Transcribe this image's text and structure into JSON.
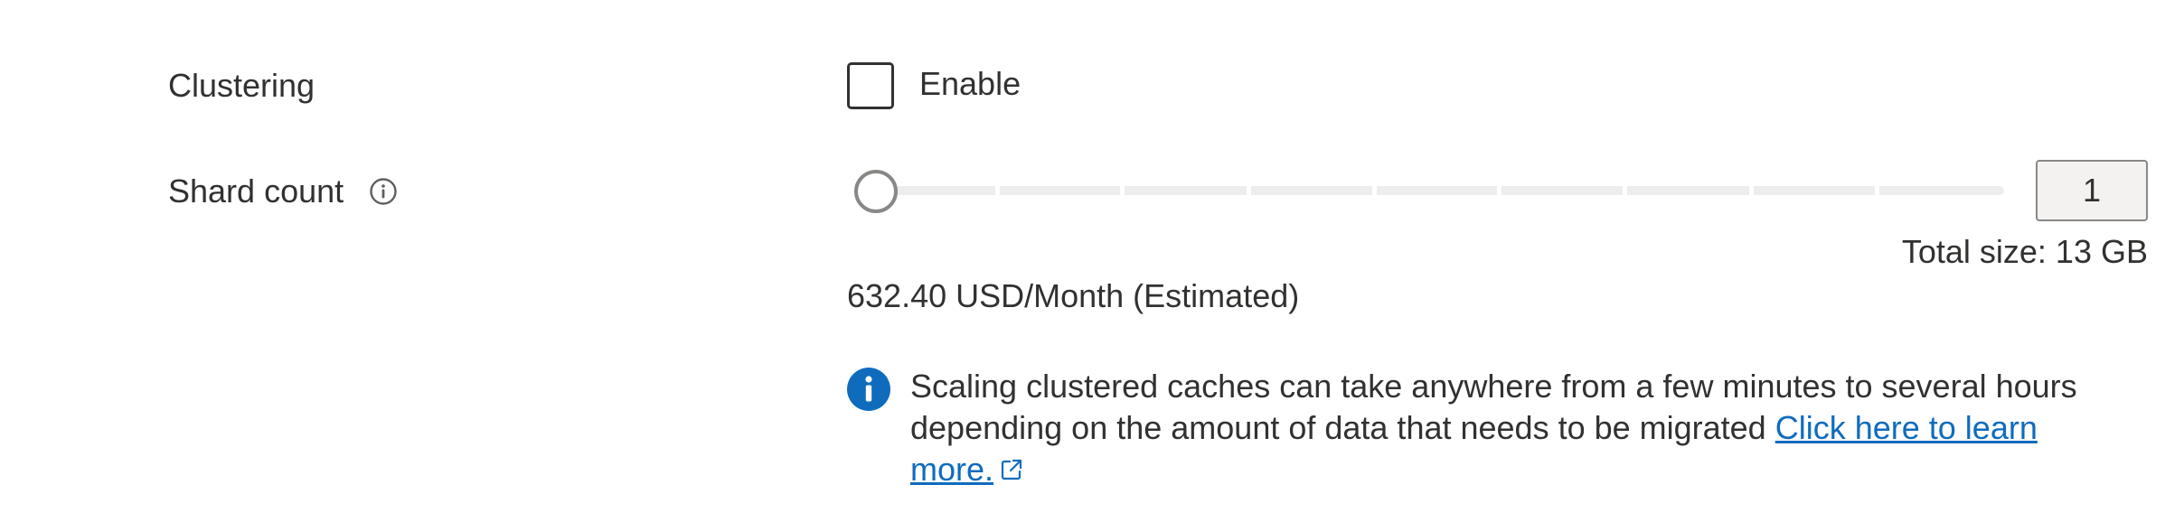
{
  "clustering": {
    "label": "Clustering",
    "checkbox_label": "Enable",
    "checked": false
  },
  "shard_count": {
    "label": "Shard count",
    "info_icon": "info-outline-icon",
    "slider_value": 1,
    "slider_min": 1,
    "slider_steps": 10,
    "value_text": "1",
    "total_size": "Total size: 13 GB"
  },
  "price": "632.40 USD/Month (Estimated)",
  "info_banner": {
    "icon": "info-solid-icon",
    "message": " Scaling clustered caches can take anywhere from a few minutes to several hours depending on the amount of data that needs to be migrated  ",
    "link_text": "Click here to learn more.",
    "link_icon": "external-link-icon"
  },
  "colors": {
    "text": "#323130",
    "link": "#0f6cbd",
    "info_icon": "#0f6cbd",
    "border": "#8a8886",
    "track": "#ededed"
  }
}
